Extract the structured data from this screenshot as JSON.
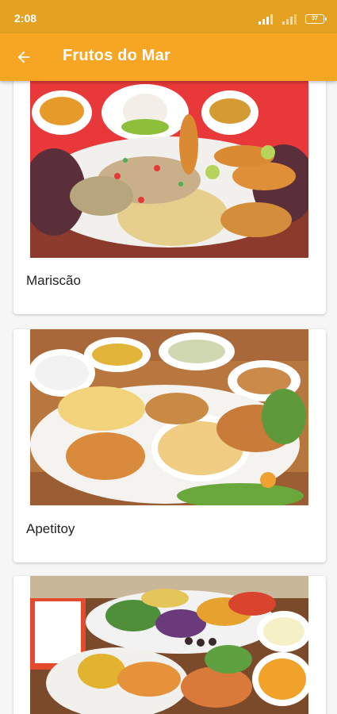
{
  "status_bar": {
    "time": "2:08",
    "battery": "37"
  },
  "app_bar": {
    "title": "Frutos do Mar"
  },
  "items": [
    {
      "name": "Mariscão"
    },
    {
      "name": "Apetitoy"
    },
    {
      "name": ""
    }
  ],
  "colors": {
    "status_bar": "#e5a222",
    "app_bar": "#f7a623",
    "background": "#f6f6f6"
  }
}
